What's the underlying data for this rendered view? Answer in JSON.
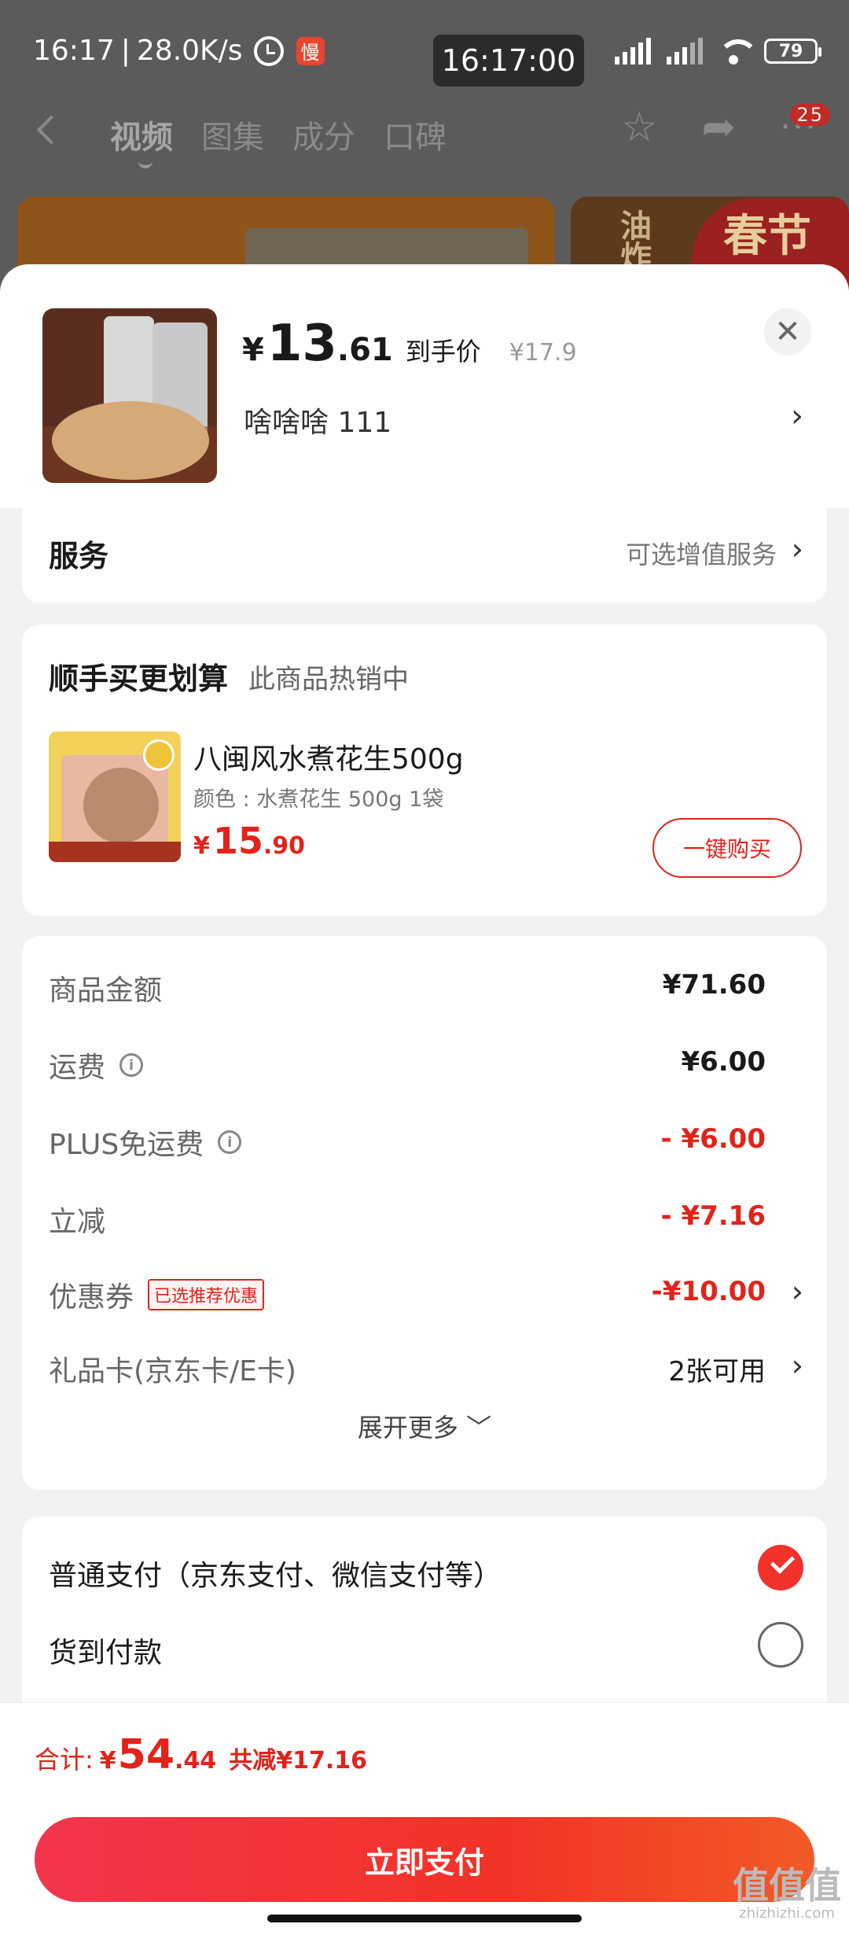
{
  "status_bar": {
    "time": "16:17",
    "speed": "28.0K/s",
    "app_badge": "慢",
    "clock": "16:17:00",
    "battery": "79"
  },
  "nav": {
    "tabs": [
      "视频",
      "图集",
      "成分",
      "口碑"
    ],
    "notif_count": "25"
  },
  "bg_promo": {
    "promo_text": "春节",
    "side_text": "油炸"
  },
  "product": {
    "price_symbol": "¥",
    "price_int": "13",
    "price_dec": ".61",
    "price_tag": "到手价",
    "orig_price": "¥17.9",
    "spec": "啥啥啥  111"
  },
  "service": {
    "label": "服务",
    "hint": "可选增值服务"
  },
  "addon": {
    "title": "顺手买更划算",
    "subtitle": "此商品热销中",
    "name": "八闽风水煮花生500g",
    "variant": "颜色 : 水煮花生 500g 1袋",
    "price_symbol": "¥",
    "price_int": "15",
    "price_dec": ".90",
    "buy_label": "一键购买"
  },
  "summary": {
    "rows": [
      {
        "label": "商品金额",
        "value": "¥71.60"
      },
      {
        "label": "运费",
        "value": "¥6.00"
      },
      {
        "label": "PLUS免运费",
        "value": "- ¥6.00"
      },
      {
        "label": "立减",
        "value": "- ¥7.16"
      },
      {
        "label": "优惠券",
        "badge": "已选推荐优惠",
        "value": "-¥10.00"
      },
      {
        "label": "礼品卡(京东卡/E卡)",
        "value": "2张可用"
      }
    ],
    "expand_label": "展开更多"
  },
  "payment": {
    "options": [
      {
        "label": "普通支付（京东支付、微信支付等）",
        "selected": true
      },
      {
        "label": "货到付款",
        "selected": false
      }
    ]
  },
  "total": {
    "label": "合计:",
    "symbol": "¥",
    "int": "54",
    "dec": ".44",
    "discount": "共减¥17.16"
  },
  "pay_button": "立即支付",
  "watermark": {
    "main": "值值值",
    "sub": "zhizhizhi.com"
  },
  "colors": {
    "accent_red": "#e2231a",
    "pay_gradient_start": "#f2354c",
    "pay_gradient_end": "#f25a26"
  }
}
